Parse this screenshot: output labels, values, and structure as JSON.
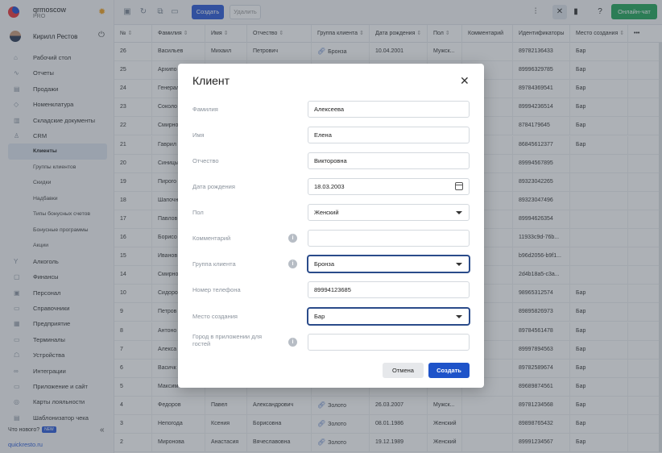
{
  "sidebar": {
    "org_name": "qrmoscow",
    "org_plan": "PRO",
    "user_name": "Кирилл Рестов",
    "items": [
      {
        "label": "Рабочий стол",
        "icon": "desktop-icon"
      },
      {
        "label": "Отчеты",
        "icon": "reports-icon"
      },
      {
        "label": "Продажи",
        "icon": "sales-icon"
      },
      {
        "label": "Номенклатура",
        "icon": "nomenclature-icon"
      },
      {
        "label": "Складские документы",
        "icon": "warehouse-icon"
      },
      {
        "label": "CRM",
        "icon": "crm-icon"
      }
    ],
    "crm_subitems": [
      {
        "label": "Клиенты",
        "active": true
      },
      {
        "label": "Группы клиентов"
      },
      {
        "label": "Скидки"
      },
      {
        "label": "Надбавки"
      },
      {
        "label": "Типы бонусных счетов"
      },
      {
        "label": "Бонусные программы"
      },
      {
        "label": "Акции"
      }
    ],
    "items2": [
      {
        "label": "Алкоголь",
        "icon": "alcohol-icon"
      },
      {
        "label": "Финансы",
        "icon": "finance-icon"
      },
      {
        "label": "Персонал",
        "icon": "staff-icon"
      },
      {
        "label": "Справочники",
        "icon": "directory-icon"
      },
      {
        "label": "Предприятие",
        "icon": "enterprise-icon"
      },
      {
        "label": "Терминалы",
        "icon": "terminal-icon"
      },
      {
        "label": "Устройства",
        "icon": "devices-icon"
      },
      {
        "label": "Интеграции",
        "icon": "integrations-icon"
      },
      {
        "label": "Приложение и сайт",
        "icon": "app-site-icon"
      },
      {
        "label": "Карты лояльности",
        "icon": "loyalty-card-icon"
      },
      {
        "label": "Шаблонизатор чека",
        "icon": "receipt-template-icon"
      }
    ],
    "whats_new": "Что нового?",
    "new_badge": "NEW",
    "site_link": "quickresto.ru"
  },
  "toolbar": {
    "create_label": "Создать",
    "delete_label": "Удалить",
    "chat_label": "Онлайн-чат"
  },
  "table": {
    "columns": [
      "№",
      "Фамилия",
      "Имя",
      "Отчество",
      "Группа клиента",
      "Дата рождения",
      "Пол",
      "Комментарий",
      "Идентификаторы",
      "Место создания"
    ],
    "rows": [
      [
        "26",
        "Васильев",
        "Михаил",
        "Петрович",
        "Бронза",
        "10.04.2001",
        "Мужск...",
        "",
        "89782136433",
        "Бар"
      ],
      [
        "25",
        "Архипо",
        "",
        "",
        "",
        "",
        "",
        "",
        "89996329785",
        "Бар"
      ],
      [
        "24",
        "Генерал",
        "",
        "",
        "",
        "",
        "",
        "",
        "89784369541",
        "Бар"
      ],
      [
        "23",
        "Соколо",
        "",
        "",
        "",
        "",
        "",
        "",
        "89994236514",
        "Бар"
      ],
      [
        "22",
        "Смирно",
        "",
        "",
        "",
        "",
        "",
        "",
        "8784179645",
        "Бар"
      ],
      [
        "21",
        "Гаврил",
        "",
        "",
        "",
        "",
        "",
        "",
        "86845612377",
        "Бар"
      ],
      [
        "20",
        "Синицы",
        "",
        "",
        "",
        "",
        "",
        "",
        "89994567895",
        ""
      ],
      [
        "19",
        "Пирого",
        "",
        "",
        "",
        "",
        "",
        "",
        "89323042265",
        ""
      ],
      [
        "18",
        "Шапочн",
        "",
        "",
        "",
        "",
        "",
        "",
        "89323047496",
        ""
      ],
      [
        "17",
        "Павлов",
        "",
        "",
        "",
        "",
        "",
        "",
        "89994626354",
        ""
      ],
      [
        "16",
        "Борисо",
        "",
        "",
        "",
        "",
        "",
        "",
        "11933c9d-76b...",
        ""
      ],
      [
        "15",
        "Иванов",
        "",
        "",
        "",
        "",
        "",
        "",
        "b96d2056-b9f1...",
        ""
      ],
      [
        "14",
        "Смирно",
        "",
        "",
        "",
        "",
        "",
        "",
        "2d4b18a5-c3a...",
        ""
      ],
      [
        "10",
        "Сидоро",
        "",
        "",
        "",
        "",
        "",
        "",
        "98965312574",
        "Бар"
      ],
      [
        "9",
        "Петров",
        "",
        "",
        "",
        "",
        "",
        "",
        "89895826973",
        "Бар"
      ],
      [
        "8",
        "Антоно",
        "",
        "",
        "",
        "",
        "",
        "",
        "89784561478",
        "Бар"
      ],
      [
        "7",
        "Алекса",
        "",
        "",
        "",
        "",
        "",
        "",
        "89997894563",
        "Бар"
      ],
      [
        "6",
        "Васичк",
        "",
        "",
        "",
        "",
        "",
        "",
        "89782589674",
        "Бар"
      ],
      [
        "5",
        "Максим",
        "",
        "",
        "",
        "",
        "",
        "",
        "89689874561",
        "Бар"
      ],
      [
        "4",
        "Федоров",
        "Павел",
        "Александрович",
        "Золото",
        "26.03.2007",
        "Мужск...",
        "",
        "89781234568",
        "Бар"
      ],
      [
        "3",
        "Непогода",
        "Ксения",
        "Борисовна",
        "Золото",
        "08.01.1986",
        "Женский",
        "",
        "89898765432",
        "Бар"
      ],
      [
        "2",
        "Миронова",
        "Анастасия",
        "Вячеславовна",
        "Золото",
        "19.12.1989",
        "Женский",
        "",
        "89991234567",
        "Бар"
      ]
    ]
  },
  "modal": {
    "title": "Клиент",
    "fields": [
      {
        "label": "Фамилия",
        "value": "Алексеева",
        "kind": "text"
      },
      {
        "label": "Имя",
        "value": "Елена",
        "kind": "text"
      },
      {
        "label": "Отчество",
        "value": "Викторовна",
        "kind": "text"
      },
      {
        "label": "Дата рождения",
        "value": "18.03.2003",
        "kind": "date"
      },
      {
        "label": "Пол",
        "value": "Женский",
        "kind": "select"
      },
      {
        "label": "Комментарий",
        "value": "",
        "kind": "text",
        "info": true
      },
      {
        "label": "Группа клиента",
        "value": "Бронза",
        "kind": "select",
        "info": true,
        "focus": true
      },
      {
        "label": "Номер телефона",
        "value": "89994123685",
        "kind": "text"
      },
      {
        "label": "Место создания",
        "value": "Бар",
        "kind": "select",
        "focus": true
      },
      {
        "label": "Город в приложении для гостей",
        "value": "",
        "kind": "text",
        "info": true
      }
    ],
    "cancel_label": "Отмена",
    "submit_label": "Создать"
  },
  "colors": {
    "accent": "#2b5bd7",
    "chat": "#22a55b",
    "submit": "#1e53c9"
  }
}
